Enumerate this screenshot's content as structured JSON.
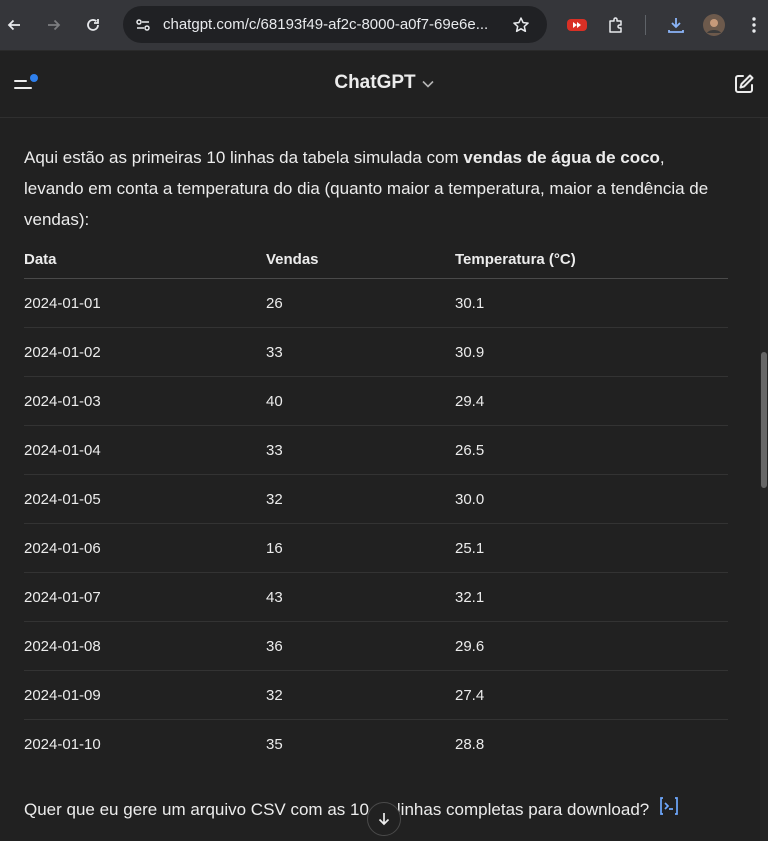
{
  "browser": {
    "url": "chatgpt.com/c/68193f49-af2c-8000-a0f7-69e6e..."
  },
  "header": {
    "title": "ChatGPT"
  },
  "message": {
    "intro_part1": "Aqui estão as primeiras 10 linhas da tabela simulada com ",
    "intro_bold": "vendas de água de coco",
    "intro_part2": ", levando em conta a temperatura do dia (quanto maior a temperatura, maior a tendência de vendas):",
    "table": {
      "headers": [
        "Data",
        "Vendas",
        "Temperatura (°C)"
      ],
      "rows": [
        [
          "2024-01-01",
          "26",
          "30.1"
        ],
        [
          "2024-01-02",
          "33",
          "30.9"
        ],
        [
          "2024-01-03",
          "40",
          "29.4"
        ],
        [
          "2024-01-04",
          "33",
          "26.5"
        ],
        [
          "2024-01-05",
          "32",
          "30.0"
        ],
        [
          "2024-01-06",
          "16",
          "25.1"
        ],
        [
          "2024-01-07",
          "43",
          "32.1"
        ],
        [
          "2024-01-08",
          "36",
          "29.6"
        ],
        [
          "2024-01-09",
          "32",
          "27.4"
        ],
        [
          "2024-01-10",
          "35",
          "28.8"
        ]
      ]
    },
    "question_a": "Quer que eu gere um arquivo CSV com as 10",
    "question_b": "linhas completas para download?"
  },
  "icons": {
    "back": "arrow-left-icon",
    "forward": "arrow-right-icon",
    "reload": "reload-icon",
    "site_settings": "tune-icon",
    "bookmark": "star-icon",
    "extension_red": "fast-forward-extension-icon",
    "extensions": "puzzle-icon",
    "download": "download-icon",
    "profile": "avatar",
    "menu": "kebab-menu-icon",
    "sidebar": "sidebar-menu-icon",
    "new_chat": "edit-icon",
    "code": "code-icon",
    "scroll_down": "arrow-down-icon"
  },
  "colors": {
    "background": "#212121",
    "browser_bar": "#35363a",
    "notification_dot": "#2f80ed",
    "download_blue": "#8ab4f8"
  }
}
